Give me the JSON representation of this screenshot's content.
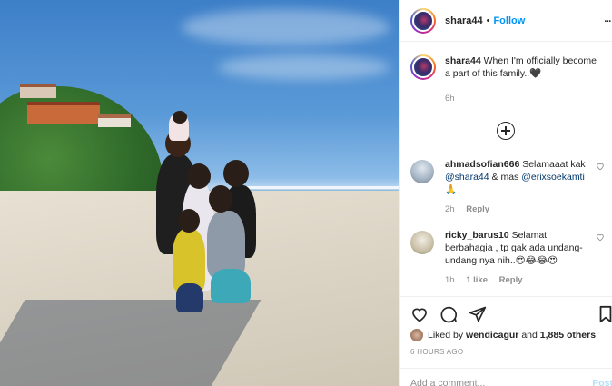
{
  "post": {
    "username": "shara44",
    "separator": "•",
    "follow_label": "Follow",
    "more_label": "...",
    "caption": "When I'm officially become a part of this family..",
    "caption_emoji": "🖤",
    "caption_time": "6h"
  },
  "comments": [
    {
      "username": "ahmadsofian666",
      "text_before": "Selamaaat kak",
      "mention1": "@shara44",
      "text_mid": "& mas",
      "mention2": "@erixsoekamti",
      "emoji": "🙏",
      "time": "2h",
      "reply_label": "Reply"
    },
    {
      "username": "ricky_barus10",
      "text": "Selamat berbahagia , tp gak ada undang-undang nya nih..",
      "emoji": "😍😂😂😍",
      "time": "1h",
      "likes": "1 like",
      "reply_label": "Reply"
    }
  ],
  "likes": {
    "prefix": "Liked by",
    "user": "wendicagur",
    "joiner": "and",
    "count": "1,885 others"
  },
  "time_ago": "6 HOURS AGO",
  "add_comment": {
    "placeholder": "Add a comment...",
    "post_label": "Post"
  },
  "colors": {
    "accent": "#0095f6",
    "mention": "#00376b",
    "muted": "#8e8e8e",
    "border": "#efefef"
  }
}
